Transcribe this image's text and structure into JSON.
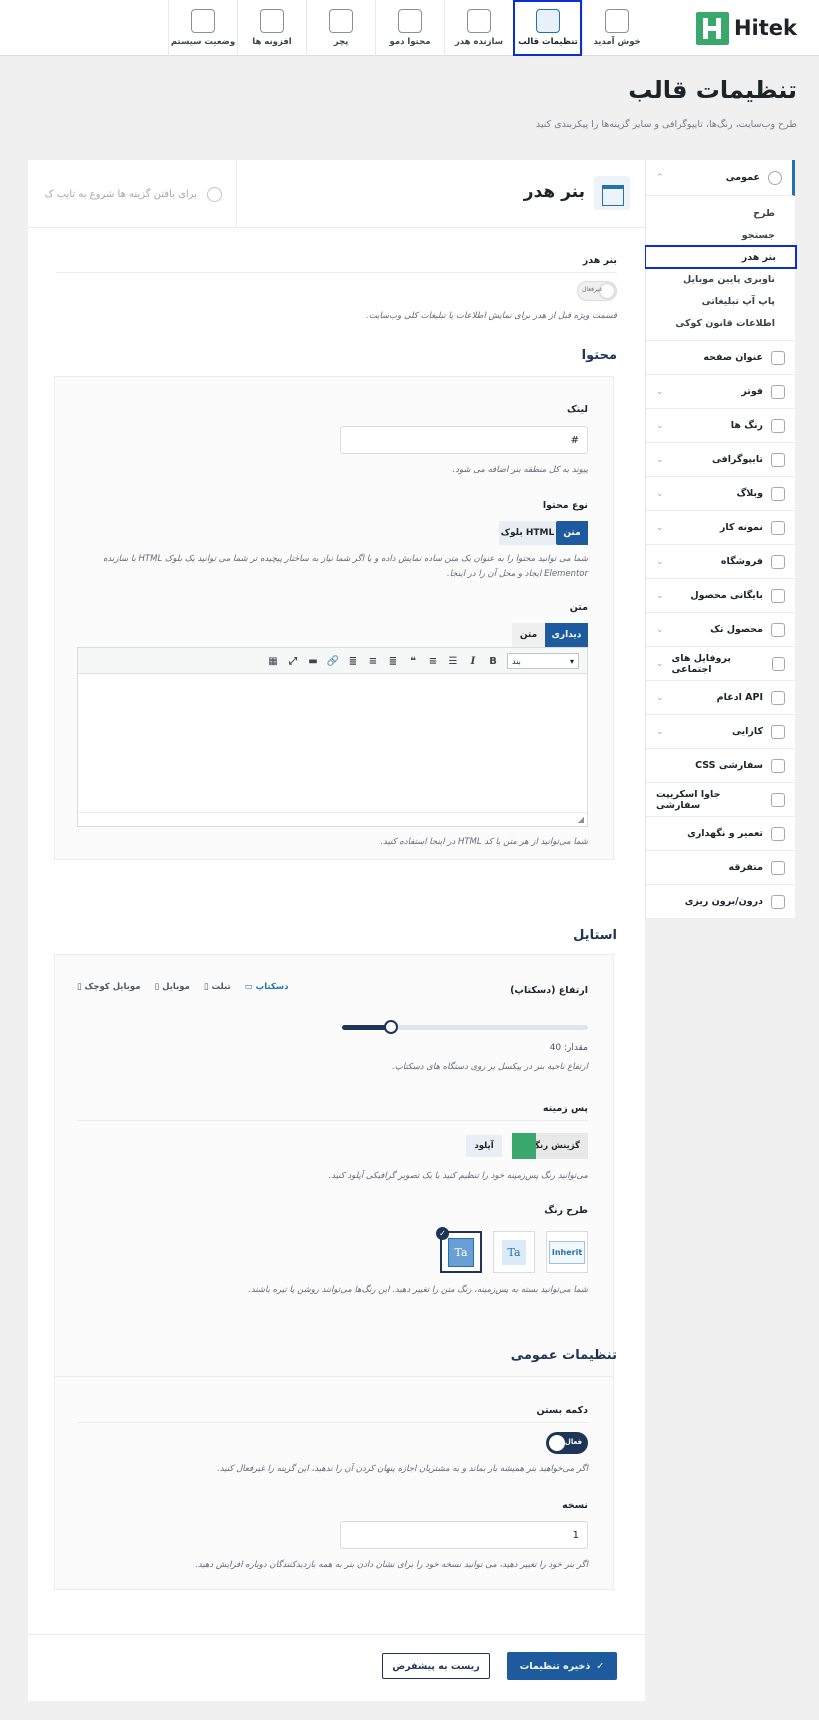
{
  "brand": {
    "name": "Hitek",
    "color": "#3aa76d"
  },
  "nav": {
    "tabs": [
      {
        "label": "خوش آمدید",
        "icon": "handshake-icon"
      },
      {
        "label": "تنظیمات قالب",
        "icon": "sliders-icon",
        "active": true
      },
      {
        "label": "سازنده هدر",
        "icon": "window-icon"
      },
      {
        "label": "محتوا دمو",
        "icon": "file-download-icon"
      },
      {
        "label": "پچر",
        "icon": "gear-icon"
      },
      {
        "label": "افزونه ها",
        "icon": "plug-icon"
      },
      {
        "label": "وضعیت سیستم",
        "icon": "system-status-icon"
      }
    ]
  },
  "page": {
    "title": "تنظیمات قالب",
    "subtitle": "طرح وب‌سایت، رنگ‌ها، تایپوگرافی و سایر گزینه‌ها را پیکربندی کنید"
  },
  "sidebar": {
    "general": {
      "label": "عمومی",
      "icon": "gear-icon"
    },
    "sub_items": [
      "طرح",
      "جستجو",
      "بنر هدر",
      "ناوبری پایین موبایل",
      "پاپ آپ تبلیغاتی",
      "اطلاعات قانون کوکی"
    ],
    "items": [
      {
        "label": "عنوان صفحه",
        "icon": "title-bar-icon",
        "chevron": false
      },
      {
        "label": "فوتر",
        "icon": "footer-icon",
        "chevron": true
      },
      {
        "label": "رنگ ها",
        "icon": "palette-icon",
        "chevron": true
      },
      {
        "label": "تایپوگرافی",
        "icon": "typography-icon",
        "chevron": true
      },
      {
        "label": "وبلاگ",
        "icon": "blog-icon",
        "chevron": true
      },
      {
        "label": "نمونه کار",
        "icon": "briefcase-icon",
        "chevron": true
      },
      {
        "label": "فروشگاه",
        "icon": "shopping-bag-icon",
        "chevron": true
      },
      {
        "label": "بایگانی محصول",
        "icon": "archive-icon",
        "chevron": true
      },
      {
        "label": "محصول تک",
        "icon": "product-icon",
        "chevron": true
      },
      {
        "label": "پروفایل های اجتماعی",
        "icon": "social-icon",
        "chevron": true
      },
      {
        "label": "ادغام API",
        "icon": "api-icon",
        "chevron": true
      },
      {
        "label": "کارایی",
        "icon": "speedometer-icon",
        "chevron": true
      },
      {
        "label": "CSS سفارشی",
        "icon": "css-file-icon",
        "chevron": false
      },
      {
        "label": "جاوا اسکریپت سفارشی",
        "icon": "js-file-icon",
        "chevron": false
      },
      {
        "label": "تعمیر و نگهداری",
        "icon": "wrench-icon",
        "chevron": false
      },
      {
        "label": "متفرقه",
        "icon": "minus-circle-icon",
        "chevron": false
      },
      {
        "label": "درون/برون ریزی",
        "icon": "import-export-icon",
        "chevron": false
      }
    ]
  },
  "panel": {
    "title": "بنر هدر",
    "search_placeholder": "برای یافتن گزینه ها شروع به تایپ ک",
    "banner": {
      "label": "بنر هدر",
      "toggle_text": "غیرفعال",
      "help": "قسمت ویژه قبل از هدر برای نمایش اطلاعات یا تبلیغات کلی وب‌سایت."
    },
    "content": {
      "title": "محتوا",
      "link_label": "لینک",
      "link_value": "#",
      "link_help": "پیوند به کل منطقه بنر اضافه می شود.",
      "type_label": "نوع محتوا",
      "type_options": [
        "متن",
        "بلوک HTML"
      ],
      "type_help": "شما می توانید محتوا را به عنوان یک متن ساده نمایش داده و یا اگر شما نیاز به ساختار پیچیده تر شما می توانید یک بلوک HTML با سازنده Elementor ایجاد و محل آن را در اینجا.",
      "text_label": "متن",
      "editor_tabs": [
        "دیداری",
        "متن"
      ],
      "format_select": "بند",
      "editor_help": "شما می‌توانید از هر متن یا کد HTML در اینجا استفاده کنید."
    },
    "style": {
      "title": "استایل",
      "height_label": "ارتفاع (دسکتاپ)",
      "devices": [
        "دسکتاپ",
        "تبلت",
        "موبایل",
        "موبایل کوچک"
      ],
      "slider_value_text": "مقدار: 40",
      "slider_value": 40,
      "slider_fraction": 0.2,
      "height_help": "ارتفاع ناحیه بنر در پیکسل بر روی دستگاه های دسکتاپ.",
      "bg_label": "پس زمینه",
      "bg_color_btn": "گزینش رنگ",
      "bg_color": "#3aa76d",
      "bg_upload_btn": "آپلود",
      "bg_help": "می‌توانید رنگ پس‌زمینه خود را تنظیم کنید یا یک تصویر گرافیکی آپلود کنید.",
      "scheme_label": "طرح رنگ",
      "scheme_options": [
        "Inherit",
        "Ta",
        "Ta"
      ],
      "scheme_help": "شما می‌توانید بسته به پس‌زمینه، رنگ متن را تغییر دهید. این رنگ‌ها می‌توانند روشن یا تیره باشند."
    },
    "general": {
      "title": "تنظیمات عمومی",
      "close_label": "دکمه بستن",
      "close_toggle_text": "فعال",
      "close_help": "اگر می‌خواهید بنر همیشه باز بماند و به مشتریان اجازه پنهان کردن آن را ندهید، این گزینه را غیرفعال کنید.",
      "version_label": "نسخه",
      "version_value": "1",
      "version_help": "اگر بنر خود را تغییر دهید، می توانید نسخه خود را برای نشان دادن بنر به همه بازدیدکنندگان دوباره افزایش دهید."
    },
    "footer": {
      "save_label": "ذخیره تنظیمات",
      "reset_label": "ریست به پیشفرض"
    }
  }
}
